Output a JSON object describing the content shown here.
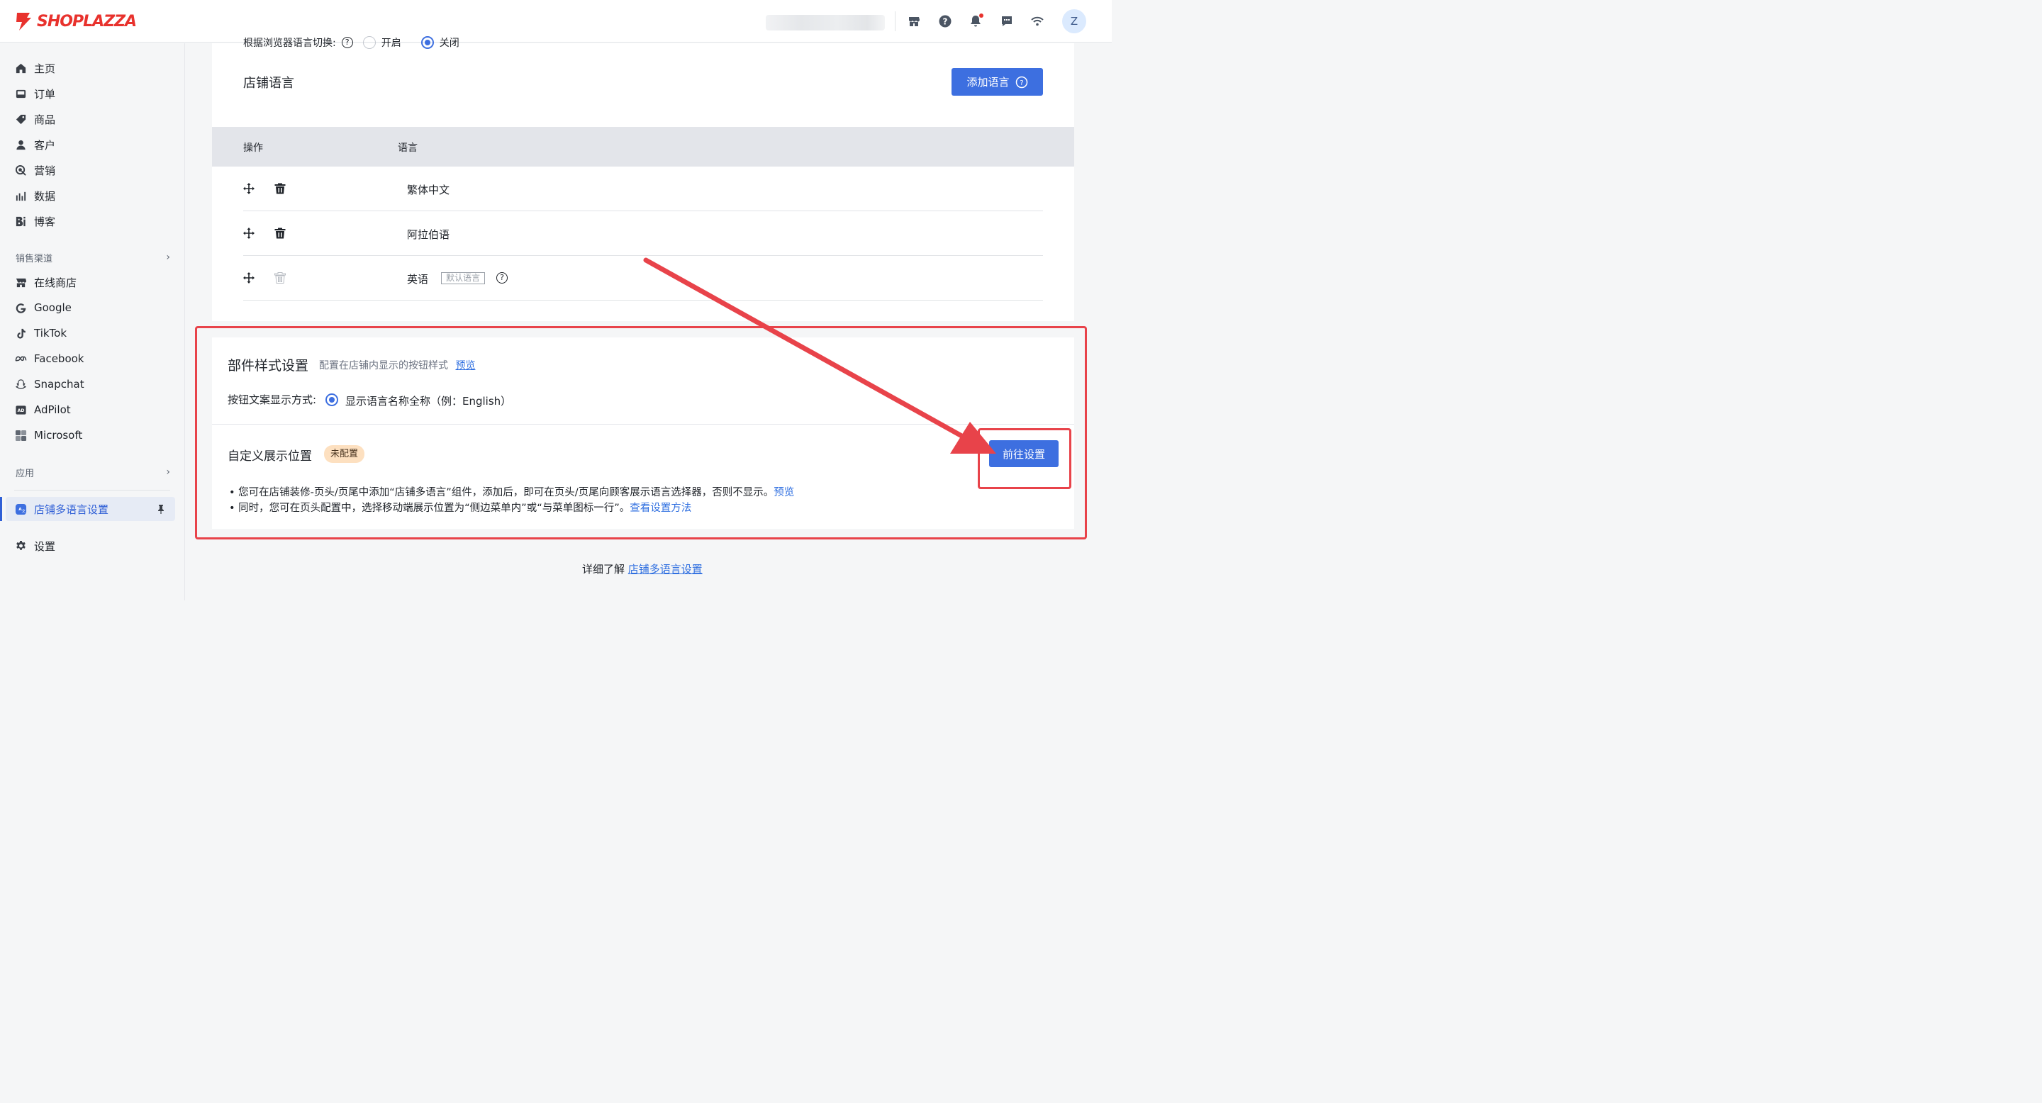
{
  "brand": {
    "name": "SHOPLAZZA",
    "color": "#e8322d"
  },
  "topbar": {
    "icons": [
      "store-icon",
      "help-icon",
      "bell-icon",
      "chat-icon",
      "wifi-icon"
    ],
    "avatar_initial": "Z"
  },
  "sidebar": {
    "main_items": [
      {
        "label": "主页",
        "icon": "home-icon"
      },
      {
        "label": "订单",
        "icon": "inbox-icon"
      },
      {
        "label": "商品",
        "icon": "tag-icon"
      },
      {
        "label": "客户",
        "icon": "user-icon"
      },
      {
        "label": "营销",
        "icon": "marketing-icon"
      },
      {
        "label": "数据",
        "icon": "bar-chart-icon"
      },
      {
        "label": "博客",
        "icon": "blog-icon"
      }
    ],
    "channels_section": "销售渠道",
    "channel_items": [
      {
        "label": "在线商店",
        "icon": "store-icon"
      },
      {
        "label": "Google",
        "icon": "google-icon"
      },
      {
        "label": "TikTok",
        "icon": "tiktok-icon"
      },
      {
        "label": "Facebook",
        "icon": "meta-icon"
      },
      {
        "label": "Snapchat",
        "icon": "snapchat-icon"
      },
      {
        "label": "AdPilot",
        "icon": "adpilot-icon"
      },
      {
        "label": "Microsoft",
        "icon": "microsoft-icon"
      }
    ],
    "apps_section": "应用",
    "active_app": {
      "label": "店铺多语言设置",
      "icon": "translate-icon"
    },
    "settings": {
      "label": "设置",
      "icon": "gear-icon"
    }
  },
  "language_card": {
    "clipped_label": "根据浏览器语言切换:",
    "clipped_on": "开启",
    "clipped_off": "关闭",
    "title": "店铺语言",
    "add_button": "添加语言",
    "columns": {
      "action": "操作",
      "language": "语言"
    },
    "rows": [
      {
        "language": "繁体中文",
        "default": false
      },
      {
        "language": "阿拉伯语",
        "default": false
      },
      {
        "language": "英语",
        "default": true,
        "default_tag": "默认语言"
      }
    ]
  },
  "widget_card": {
    "title": "部件样式设置",
    "subtitle": "配置在店铺内显示的按钮样式",
    "preview_link": "预览",
    "display_mode_label": "按钮文案显示方式:",
    "display_mode_option": "显示语言名称全称（例：English）",
    "custom_title": "自定义展示位置",
    "custom_badge": "未配置",
    "goto_button": "前往设置",
    "bullet_1_text": "您可在店铺装修-页头/页尾中添加“店铺多语言”组件，添加后，即可在页头/页尾向顾客展示语言选择器，否则不显示。",
    "bullet_1_link": "预览",
    "bullet_2_text": "同时，您可在页头配置中，选择移动端展示位置为“侧边菜单内”或“与菜单图标一行”。",
    "bullet_2_link": "查看设置方法"
  },
  "footer": {
    "text": "详细了解",
    "link": "店铺多语言设置"
  },
  "colors": {
    "primary": "#3d6fe0",
    "annotation_red": "#e8434a",
    "badge_bg": "#fde0c0"
  }
}
